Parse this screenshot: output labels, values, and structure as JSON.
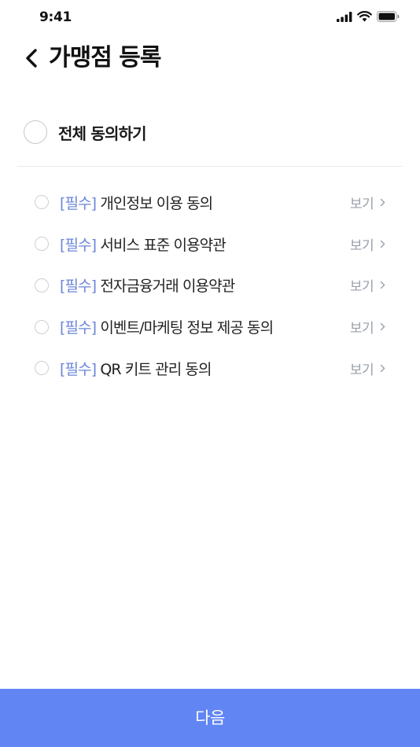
{
  "status_bar": {
    "time": "9:41"
  },
  "header": {
    "title": "가맹점 등록"
  },
  "agree_all": {
    "label": "전체 동의하기"
  },
  "terms": [
    {
      "tag": "[필수]",
      "label": "개인정보 이용 동의",
      "view": "보기"
    },
    {
      "tag": "[필수]",
      "label": "서비스 표준 이용약관",
      "view": "보기"
    },
    {
      "tag": "[필수]",
      "label": "전자금융거래 이용약관",
      "view": "보기"
    },
    {
      "tag": "[필수]",
      "label": "이벤트/마케팅 정보 제공 동의",
      "view": "보기"
    },
    {
      "tag": "[필수]",
      "label": "QR 키트 관리 동의",
      "view": "보기"
    }
  ],
  "footer": {
    "next_label": "다음"
  },
  "colors": {
    "accent": "#6185f3",
    "tag": "#6b85d9",
    "muted": "#9aa0aa"
  }
}
